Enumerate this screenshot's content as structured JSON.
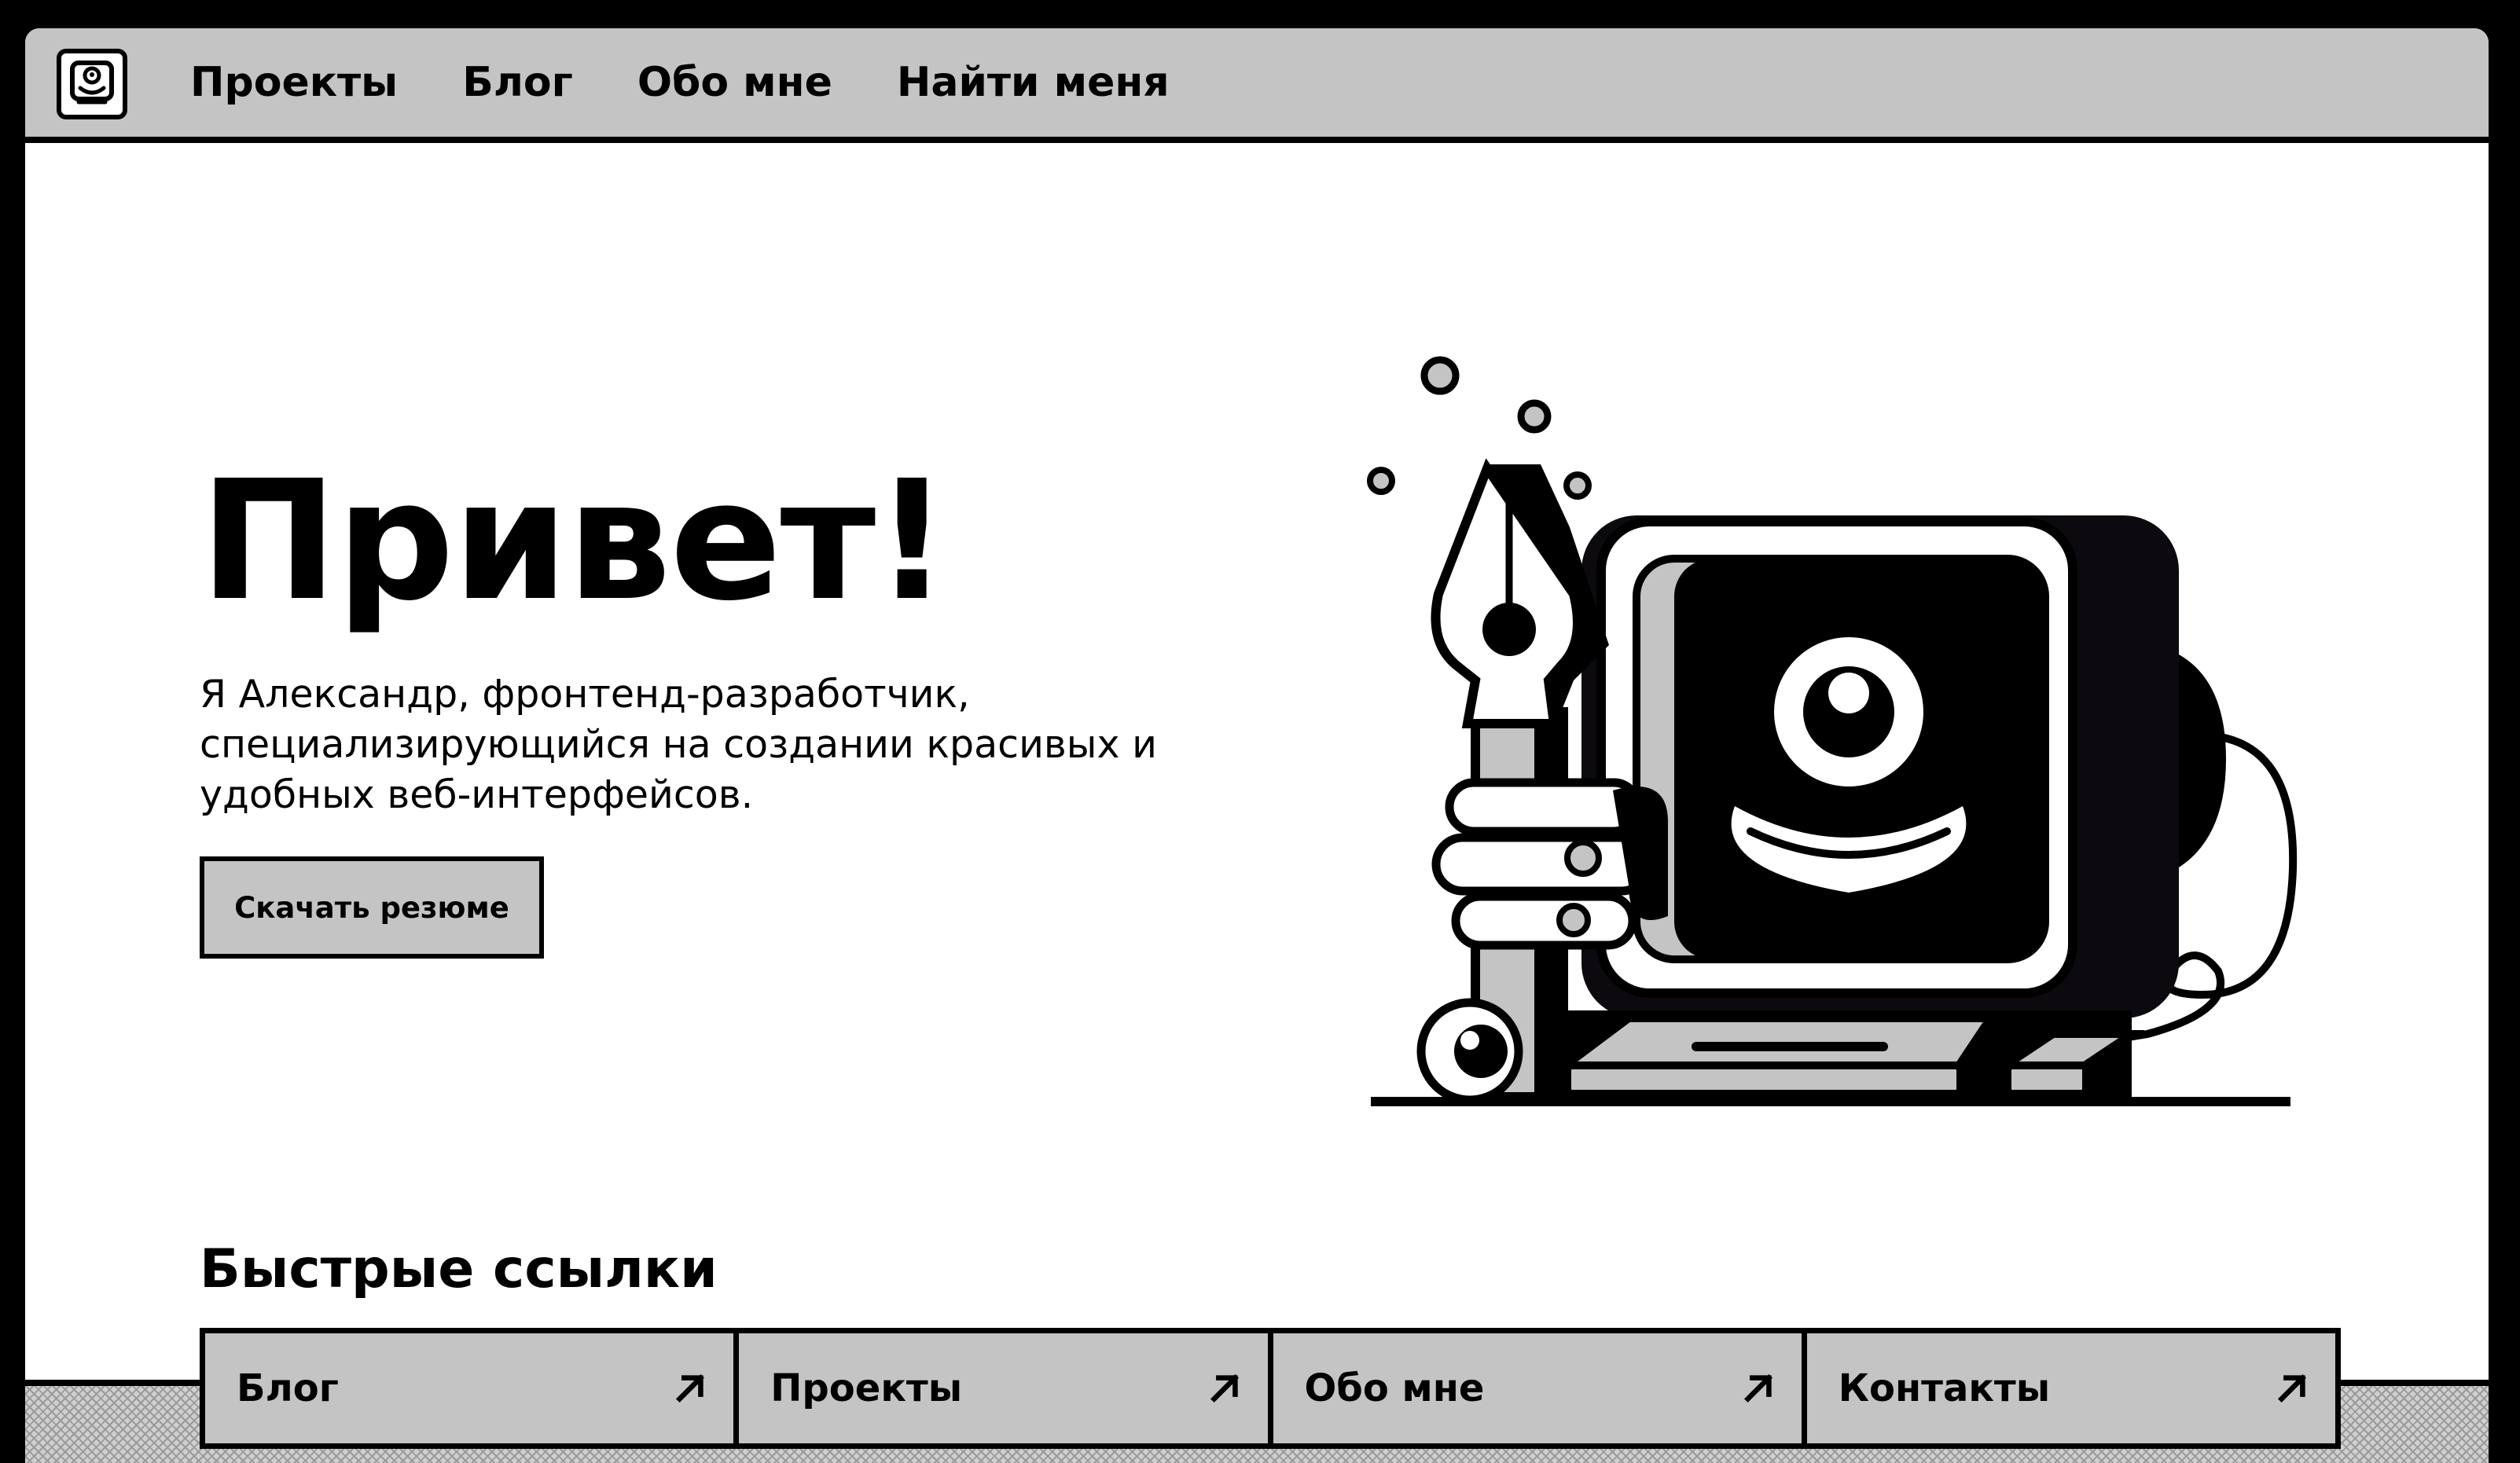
{
  "nav": {
    "logo_icon": "monitor-face-icon",
    "items": [
      {
        "label": "Проекты"
      },
      {
        "label": "Блог"
      },
      {
        "label": "Обо мне"
      },
      {
        "label": "Найти меня"
      }
    ]
  },
  "hero": {
    "title": "Привет!",
    "description": "Я Александр, фронтенд-разработчик, специализирующийся на создании красивых и удобных веб-интерфейсов.",
    "resume_button": "Скачать резюме",
    "illustration_icon": "computer-with-pen-illustration"
  },
  "quick_links": {
    "title": "Быстрые ссылки",
    "items": [
      {
        "label": "Блог",
        "icon": "arrow-up-right-icon"
      },
      {
        "label": "Проекты",
        "icon": "arrow-up-right-icon"
      },
      {
        "label": "Обо мне",
        "icon": "arrow-up-right-icon"
      },
      {
        "label": "Контакты",
        "icon": "arrow-up-right-icon"
      }
    ]
  },
  "colors": {
    "frame": "#000000",
    "nav_background": "#c4c4c4",
    "page_background": "#ffffff",
    "accent_gray": "#c4c4c4"
  }
}
